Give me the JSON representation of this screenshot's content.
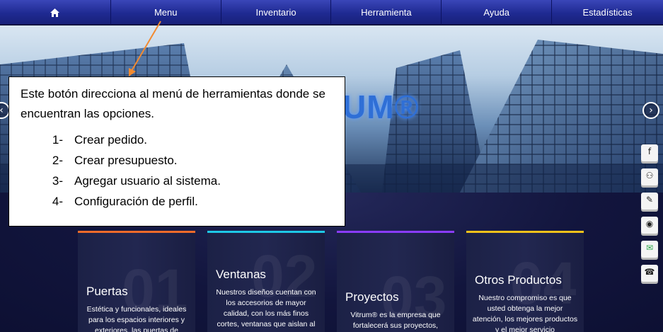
{
  "nav": {
    "home_icon": "home-icon",
    "items": [
      {
        "label": "Menu"
      },
      {
        "label": "Inventario"
      },
      {
        "label": "Herramienta"
      },
      {
        "label": "Ayuda"
      },
      {
        "label": "Estadísticas"
      }
    ]
  },
  "hero": {
    "logo_text": "UM®",
    "prev_icon": "chevron-left-icon",
    "next_icon": "chevron-right-icon"
  },
  "cards": [
    {
      "number": "01",
      "title": "Puertas",
      "text": "Estética y funcionales, ideales para los espacios interiores y exteriores, las puertas de",
      "accent": "#f26b2a"
    },
    {
      "number": "02",
      "title": "Ventanas",
      "text": "Nuestros diseños cuentan con los accesorios de mayor calidad, con los más finos cortes, ventanas que aislan al",
      "accent": "#1ec8e6"
    },
    {
      "number": "03",
      "title": "Proyectos",
      "text": "Vitrum® es la empresa que fortalecerá sus proyectos,",
      "accent": "#8a3cff"
    },
    {
      "number": "04",
      "title": "Otros Productos",
      "text": "Nuestro compromiso es que usted obtenga la mejor atención, los mejores productos y el mejor servicio",
      "accent": "#f4c21a"
    }
  ],
  "social_icons": [
    "facebook-icon",
    "share-icon",
    "edit-icon",
    "eye-icon",
    "message-icon",
    "phone-icon"
  ],
  "annotation": {
    "intro": "Este botón direcciona al menú de herramientas donde se encuentran las opciones.",
    "items": [
      {
        "index": "1-",
        "text": "Crear pedido."
      },
      {
        "index": "2-",
        "text": "Crear presupuesto."
      },
      {
        "index": "3-",
        "text": "Agregar usuario al sistema."
      },
      {
        "index": "4-",
        "text": "Configuración de perfil."
      }
    ],
    "arrow_color": "#f28a30"
  }
}
